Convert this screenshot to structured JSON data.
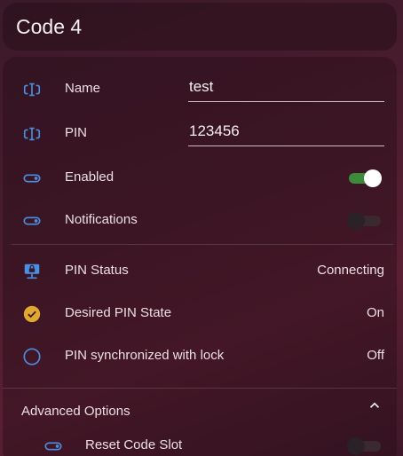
{
  "header": {
    "title": "Code 4"
  },
  "fields": {
    "name": {
      "label": "Name",
      "value": "test"
    },
    "pin": {
      "label": "PIN",
      "value": "123456"
    }
  },
  "switches": {
    "enabled": {
      "label": "Enabled",
      "on": true
    },
    "notifications": {
      "label": "Notifications",
      "on": false
    }
  },
  "status": {
    "pin_status": {
      "label": "PIN Status",
      "value": "Connecting"
    },
    "desired_state": {
      "label": "Desired PIN State",
      "value": "On"
    },
    "synchronized": {
      "label": "PIN synchronized with lock",
      "value": "Off"
    }
  },
  "advanced": {
    "label": "Advanced Options",
    "reset": {
      "label": "Reset Code Slot",
      "on": false
    }
  },
  "colors": {
    "icon_blue": "#4a90e2",
    "icon_gold": "#e0a82e",
    "toggle_on": "#3c8b3a"
  }
}
